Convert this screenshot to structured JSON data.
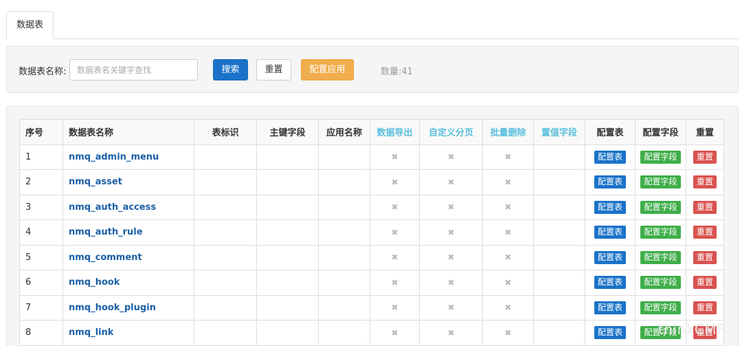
{
  "tabs": [
    {
      "label": "数据表"
    }
  ],
  "search": {
    "label": "数据表名称:",
    "placeholder": "数据表名关键字查找",
    "value": "",
    "search_label": "搜索",
    "reset_label": "重置",
    "apply_label": "配置应用",
    "count_text": "数量:41"
  },
  "table": {
    "headers": [
      "序号",
      "数据表名称",
      "表标识",
      "主键字段",
      "应用名称",
      "数据导出",
      "自定义分页",
      "批量删除",
      "置值字段",
      "配置表",
      "配置字段",
      "重置"
    ],
    "cross": "✖",
    "action_labels": {
      "config_table": "配置表",
      "config_fields": "配置字段",
      "reset": "重置"
    },
    "rows": [
      {
        "id": "1",
        "name": "nmq_admin_menu",
        "identifier": "",
        "primary_key": "",
        "app_name": ""
      },
      {
        "id": "2",
        "name": "nmq_asset",
        "identifier": "",
        "primary_key": "",
        "app_name": ""
      },
      {
        "id": "3",
        "name": "nmq_auth_access",
        "identifier": "",
        "primary_key": "",
        "app_name": ""
      },
      {
        "id": "4",
        "name": "nmq_auth_rule",
        "identifier": "",
        "primary_key": "",
        "app_name": ""
      },
      {
        "id": "5",
        "name": "nmq_comment",
        "identifier": "",
        "primary_key": "",
        "app_name": ""
      },
      {
        "id": "6",
        "name": "nmq_hook",
        "identifier": "",
        "primary_key": "",
        "app_name": ""
      },
      {
        "id": "7",
        "name": "nmq_hook_plugin",
        "identifier": "",
        "primary_key": "",
        "app_name": ""
      },
      {
        "id": "8",
        "name": "nmq_link",
        "identifier": "",
        "primary_key": "",
        "app_name": ""
      }
    ]
  },
  "watermark": "thinkCMF",
  "colors": {
    "primary": "#1a73c9",
    "success": "#3fae49",
    "danger": "#d9534f",
    "warning": "#f0ad4e",
    "info": "#5bc0de",
    "link": "#1a5fa6"
  }
}
